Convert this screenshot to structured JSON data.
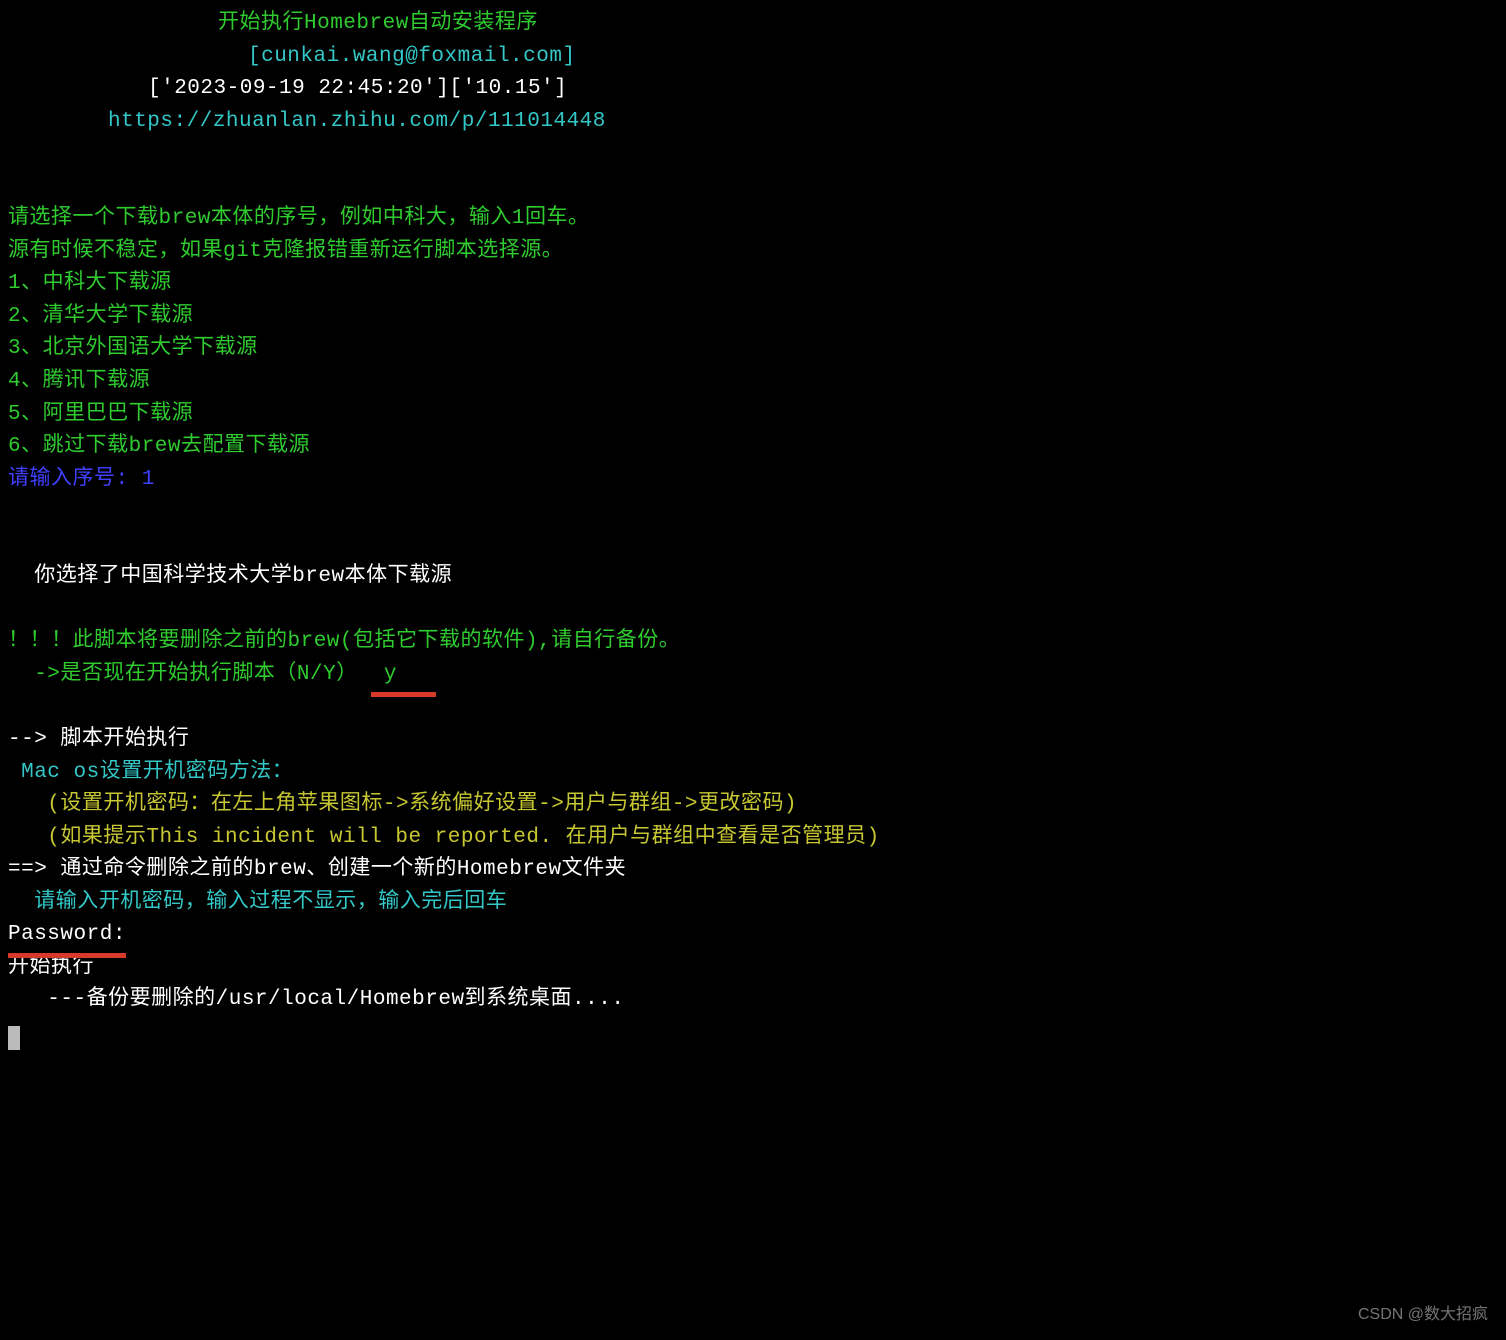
{
  "header": {
    "title": "开始执行Homebrew自动安装程序",
    "email": "[cunkai.wang@foxmail.com]",
    "timestamp": "['2023-09-19 22:45:20']['10.15']",
    "url": "https://zhuanlan.zhihu.com/p/111014448"
  },
  "prompt1": {
    "line1": "请选择一个下载brew本体的序号，例如中科大，输入1回车。",
    "line2": "源有时候不稳定，如果git克隆报错重新运行脚本选择源。",
    "options": [
      "1、中科大下载源",
      "2、清华大学下载源",
      "3、北京外国语大学下载源",
      "4、腾讯下载源",
      "5、阿里巴巴下载源",
      "6、跳过下载brew去配置下载源"
    ],
    "input_label": "请输入序号: ",
    "input_value": "1"
  },
  "selected": "  你选择了中国科学技术大学brew本体下载源",
  "warning": {
    "line1": "！！！此脚本将要删除之前的brew(包括它下载的软件),请自行备份。",
    "confirm_label": "  ->是否现在开始执行脚本（N/Y） ",
    "confirm_value": " y   "
  },
  "exec": {
    "start": "--> 脚本开始执行",
    "mac_tip": " Mac os设置开机密码方法：",
    "tip1": "   (设置开机密码：在左上角苹果图标->系统偏好设置->用户与群组->更改密码)",
    "tip2": "   (如果提示This incident will be reported. 在用户与群组中查看是否管理员)",
    "step": "==> 通过命令删除之前的brew、创建一个新的Homebrew文件夹",
    "pw_prompt": "  请输入开机密码，输入过程不显示，输入完后回车",
    "pw_label": "Password:",
    "begin": "开始执行",
    "backup": "   ---备份要删除的/usr/local/Homebrew到系统桌面...."
  },
  "watermark": "CSDN @数大招疯"
}
